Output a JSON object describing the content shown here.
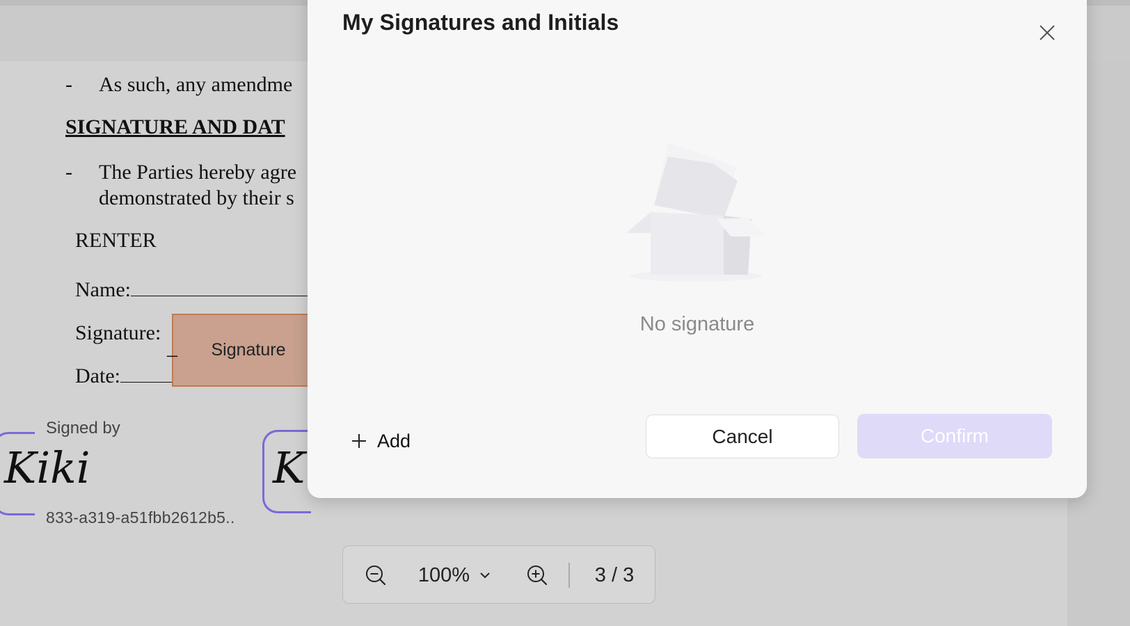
{
  "document": {
    "line_amendment": "As such, any amendme",
    "heading": "SIGNATURE AND DAT",
    "line_parties_1": "The Parties hereby agre",
    "line_parties_2": "demonstrated by their s",
    "renter_label": "RENTER",
    "name_label": "Name:",
    "signature_label": "Signature:",
    "date_label": "Date:",
    "dash": "-",
    "signature_field_label": "Signature"
  },
  "stamp": {
    "signed_by": "Signed by",
    "script_name": "Kiki",
    "script_partial": "K",
    "id_text": "833-a319-a51fbb2612b5.."
  },
  "zoom_bar": {
    "zoom_level": "100%",
    "page_indicator": "3 / 3"
  },
  "modal": {
    "title": "My Signatures and Initials",
    "empty_text": "No signature",
    "add_label": "Add",
    "cancel_label": "Cancel",
    "confirm_label": "Confirm"
  },
  "colors": {
    "accent_light": "#dedaf8",
    "stamp_border": "#7d68d8",
    "signature_field": "#c9a18e"
  }
}
